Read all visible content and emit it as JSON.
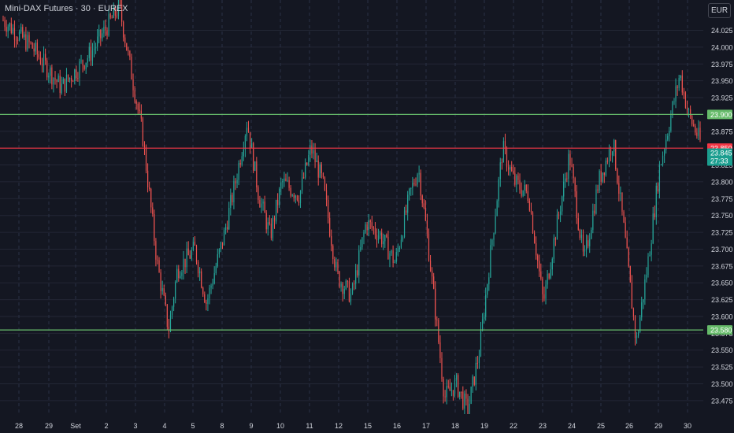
{
  "header": {
    "title": "Mini-DAX Futures · 30 · EUREX",
    "currency": "EUR"
  },
  "colors": {
    "background": "#141722",
    "grid": "#232735",
    "up": "#26a69a",
    "down": "#ef5350",
    "support_line": "#66bb6a",
    "pivot_line": "#f23645",
    "axis_text": "#d1d4dc"
  },
  "chart_data": {
    "type": "candlestick",
    "title": "Mini-DAX Futures · 30 · EUREX",
    "ylim": [
      23.455,
      24.07
    ],
    "y_ticks": [
      "24.025",
      "24.000",
      "23.975",
      "23.950",
      "23.925",
      "23.900",
      "23.875",
      "23.850",
      "23.825",
      "23.800",
      "23.775",
      "23.750",
      "23.725",
      "23.700",
      "23.675",
      "23.650",
      "23.625",
      "23.600",
      "23.575",
      "23.550",
      "23.525",
      "23.500",
      "23.475"
    ],
    "x_ticks": [
      "28",
      "29",
      "Set",
      "2",
      "3",
      "4",
      "5",
      "8",
      "9",
      "10",
      "11",
      "12",
      "15",
      "16",
      "17",
      "18",
      "19",
      "22",
      "23",
      "24",
      "25",
      "26",
      "29",
      "30"
    ],
    "horizontal_lines": [
      {
        "value": 23.9,
        "label": "23.900",
        "color": "#66bb6a"
      },
      {
        "value": 23.85,
        "label": "23.850",
        "color": "#f23645"
      },
      {
        "value": 23.58,
        "label": "23.580",
        "color": "#66bb6a"
      }
    ],
    "last_price": {
      "value": 23.845,
      "label": "23.845",
      "countdown": "27:33"
    },
    "path_keypoints": [
      [
        0,
        24.04
      ],
      [
        1,
        24.0
      ],
      [
        2,
        23.94
      ],
      [
        3,
        23.99
      ],
      [
        4,
        24.06
      ],
      [
        4.8,
        23.87
      ],
      [
        5.3,
        23.68
      ],
      [
        5.7,
        23.58
      ],
      [
        6,
        23.67
      ],
      [
        6.6,
        23.7
      ],
      [
        7,
        23.62
      ],
      [
        7.6,
        23.72
      ],
      [
        8,
        23.8
      ],
      [
        8.4,
        23.89
      ],
      [
        8.8,
        23.78
      ],
      [
        9.2,
        23.72
      ],
      [
        9.6,
        23.8
      ],
      [
        10.2,
        23.78
      ],
      [
        10.6,
        23.85
      ],
      [
        11,
        23.8
      ],
      [
        11.5,
        23.66
      ],
      [
        12,
        23.63
      ],
      [
        12.5,
        23.74
      ],
      [
        13,
        23.72
      ],
      [
        13.5,
        23.68
      ],
      [
        14,
        23.78
      ],
      [
        14.3,
        23.82
      ],
      [
        14.6,
        23.72
      ],
      [
        14.9,
        23.6
      ],
      [
        15.2,
        23.48
      ],
      [
        15.6,
        23.5
      ],
      [
        16,
        23.46
      ],
      [
        16.4,
        23.55
      ],
      [
        16.8,
        23.7
      ],
      [
        17.2,
        23.85
      ],
      [
        17.6,
        23.8
      ],
      [
        18.1,
        23.78
      ],
      [
        18.6,
        23.62
      ],
      [
        19,
        23.72
      ],
      [
        19.5,
        23.84
      ],
      [
        20,
        23.68
      ],
      [
        20.5,
        23.8
      ],
      [
        21,
        23.86
      ],
      [
        21.4,
        23.72
      ],
      [
        21.8,
        23.56
      ],
      [
        22.2,
        23.68
      ],
      [
        22.6,
        23.82
      ],
      [
        23,
        23.9
      ],
      [
        23.3,
        23.96
      ],
      [
        23.6,
        23.9
      ],
      [
        24,
        23.86
      ]
    ]
  }
}
